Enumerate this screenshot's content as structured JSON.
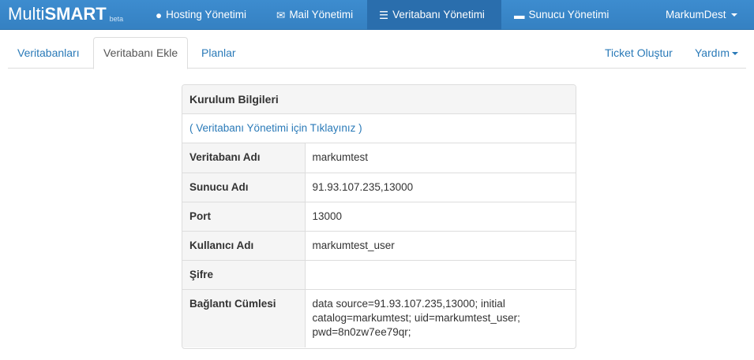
{
  "brand": {
    "part1": "Multi",
    "part2": "SMART",
    "tag": "beta"
  },
  "navbar": {
    "items": [
      {
        "label": "Hosting Yönetimi",
        "icon": "globe-icon",
        "glyph": "●"
      },
      {
        "label": "Mail Yönetimi",
        "icon": "envelope-icon",
        "glyph": "✉"
      },
      {
        "label": "Veritabanı Yönetimi",
        "icon": "list-icon",
        "glyph": "☰"
      },
      {
        "label": "Sunucu Yönetimi",
        "icon": "server-icon",
        "glyph": "▬"
      }
    ],
    "user": "MarkumDest"
  },
  "tabs": {
    "items": [
      "Veritabanları",
      "Veritabanı Ekle",
      "Planlar"
    ],
    "active": "Veritabanı Ekle",
    "right": [
      "Ticket Oluştur",
      "Yardım"
    ]
  },
  "panel": {
    "heading": "Kurulum Bilgileri",
    "link_prefix": "( ",
    "link_text": "Veritabanı Yönetimi için Tıklayınız",
    "link_suffix": " )",
    "rows": [
      {
        "key": "Veritabanı Adı",
        "value": "markumtest"
      },
      {
        "key": "Sunucu Adı",
        "value": "91.93.107.235,13000"
      },
      {
        "key": "Port",
        "value": "13000"
      },
      {
        "key": "Kullanıcı Adı",
        "value": "markumtest_user"
      },
      {
        "key": "Şifre",
        "value": ""
      },
      {
        "key": "Bağlantı Cümlesi",
        "value": "data source=91.93.107.235,13000; initial catalog=markumtest; uid=markumtest_user; pwd=8n0zw7ee79qr;"
      }
    ]
  },
  "colors": {
    "navbar": "#3a87c8",
    "navbar_active": "#2a6ead",
    "link": "#2a7ab8",
    "border": "#dddddd"
  }
}
